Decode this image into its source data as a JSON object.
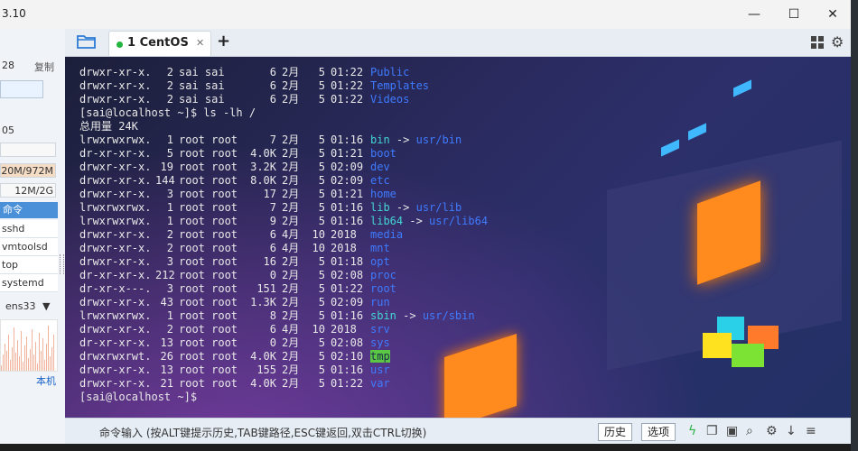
{
  "window": {
    "title_fragment": "3.10",
    "controls": {
      "minimize": "—",
      "maximize": "☐",
      "close": "✕"
    }
  },
  "left_panel": {
    "ip_fragment": "28",
    "copy_label": "复制",
    "load_fragment": "05",
    "mem_usage": "20M/972M",
    "swap_usage": "12M/2G",
    "process_header": "命令",
    "processes": [
      "sshd",
      "vmtoolsd",
      "top",
      "systemd"
    ],
    "net_interface": "ens33",
    "local_label": "本机"
  },
  "tabs": [
    {
      "label": "1 CentOS",
      "status_color": "#25b53e"
    }
  ],
  "terminal": {
    "top_entries": [
      {
        "perm": "drwxr-xr-x.",
        "links": "2",
        "owner": "sai sai",
        "size": "6",
        "month": "2月",
        "day": "5",
        "time": "01:22",
        "name": "Public"
      },
      {
        "perm": "drwxr-xr-x.",
        "links": "2",
        "owner": "sai sai",
        "size": "6",
        "month": "2月",
        "day": "5",
        "time": "01:22",
        "name": "Templates"
      },
      {
        "perm": "drwxr-xr-x.",
        "links": "2",
        "owner": "sai sai",
        "size": "6",
        "month": "2月",
        "day": "5",
        "time": "01:22",
        "name": "Videos"
      }
    ],
    "prompt_command": "[sai@localhost ~]$ ls -lh /",
    "total": "总用量 24K",
    "entries": [
      {
        "perm": "lrwxrwxrwx.",
        "links": "1",
        "owner": "root root",
        "size": "7",
        "month": "2月",
        "day": "5",
        "time": "01:16",
        "name": "bin",
        "target": "usr/bin",
        "kind": "link"
      },
      {
        "perm": "dr-xr-xr-x.",
        "links": "5",
        "owner": "root root",
        "size": "4.0K",
        "month": "2月",
        "day": "5",
        "time": "01:21",
        "name": "boot",
        "target": "",
        "kind": "dir"
      },
      {
        "perm": "drwxr-xr-x.",
        "links": "19",
        "owner": "root root",
        "size": "3.2K",
        "month": "2月",
        "day": "5",
        "time": "02:09",
        "name": "dev",
        "target": "",
        "kind": "dir"
      },
      {
        "perm": "drwxr-xr-x.",
        "links": "144",
        "owner": "root root",
        "size": "8.0K",
        "month": "2月",
        "day": "5",
        "time": "02:09",
        "name": "etc",
        "target": "",
        "kind": "dir"
      },
      {
        "perm": "drwxr-xr-x.",
        "links": "3",
        "owner": "root root",
        "size": "17",
        "month": "2月",
        "day": "5",
        "time": "01:21",
        "name": "home",
        "target": "",
        "kind": "dir"
      },
      {
        "perm": "lrwxrwxrwx.",
        "links": "1",
        "owner": "root root",
        "size": "7",
        "month": "2月",
        "day": "5",
        "time": "01:16",
        "name": "lib",
        "target": "usr/lib",
        "kind": "link"
      },
      {
        "perm": "lrwxrwxrwx.",
        "links": "1",
        "owner": "root root",
        "size": "9",
        "month": "2月",
        "day": "5",
        "time": "01:16",
        "name": "lib64",
        "target": "usr/lib64",
        "kind": "link"
      },
      {
        "perm": "drwxr-xr-x.",
        "links": "2",
        "owner": "root root",
        "size": "6",
        "month": "4月",
        "day": "10",
        "time": "2018",
        "name": "media",
        "target": "",
        "kind": "dir"
      },
      {
        "perm": "drwxr-xr-x.",
        "links": "2",
        "owner": "root root",
        "size": "6",
        "month": "4月",
        "day": "10",
        "time": "2018",
        "name": "mnt",
        "target": "",
        "kind": "dir"
      },
      {
        "perm": "drwxr-xr-x.",
        "links": "3",
        "owner": "root root",
        "size": "16",
        "month": "2月",
        "day": "5",
        "time": "01:18",
        "name": "opt",
        "target": "",
        "kind": "dir"
      },
      {
        "perm": "dr-xr-xr-x.",
        "links": "212",
        "owner": "root root",
        "size": "0",
        "month": "2月",
        "day": "5",
        "time": "02:08",
        "name": "proc",
        "target": "",
        "kind": "dir"
      },
      {
        "perm": "dr-xr-x---.",
        "links": "3",
        "owner": "root root",
        "size": "151",
        "month": "2月",
        "day": "5",
        "time": "01:22",
        "name": "root",
        "target": "",
        "kind": "dir"
      },
      {
        "perm": "drwxr-xr-x.",
        "links": "43",
        "owner": "root root",
        "size": "1.3K",
        "month": "2月",
        "day": "5",
        "time": "02:09",
        "name": "run",
        "target": "",
        "kind": "dir"
      },
      {
        "perm": "lrwxrwxrwx.",
        "links": "1",
        "owner": "root root",
        "size": "8",
        "month": "2月",
        "day": "5",
        "time": "01:16",
        "name": "sbin",
        "target": "usr/sbin",
        "kind": "link"
      },
      {
        "perm": "drwxr-xr-x.",
        "links": "2",
        "owner": "root root",
        "size": "6",
        "month": "4月",
        "day": "10",
        "time": "2018",
        "name": "srv",
        "target": "",
        "kind": "dir"
      },
      {
        "perm": "dr-xr-xr-x.",
        "links": "13",
        "owner": "root root",
        "size": "0",
        "month": "2月",
        "day": "5",
        "time": "02:08",
        "name": "sys",
        "target": "",
        "kind": "dir"
      },
      {
        "perm": "drwxrwxrwt.",
        "links": "26",
        "owner": "root root",
        "size": "4.0K",
        "month": "2月",
        "day": "5",
        "time": "02:10",
        "name": "tmp",
        "target": "",
        "kind": "sticky"
      },
      {
        "perm": "drwxr-xr-x.",
        "links": "13",
        "owner": "root root",
        "size": "155",
        "month": "2月",
        "day": "5",
        "time": "01:16",
        "name": "usr",
        "target": "",
        "kind": "dir"
      },
      {
        "perm": "drwxr-xr-x.",
        "links": "21",
        "owner": "root root",
        "size": "4.0K",
        "month": "2月",
        "day": "5",
        "time": "01:22",
        "name": "var",
        "target": "",
        "kind": "dir"
      }
    ],
    "final_prompt": "[sai@localhost ~]$"
  },
  "command_bar": {
    "hint": "命令输入 (按ALT键提示历史,TAB键路径,ESC键返回,双击CTRL切换)",
    "history_button": "历史",
    "options_button": "选项",
    "icons": [
      "lightning-icon",
      "copy-icon",
      "files-icon",
      "search-icon",
      "gear-icon",
      "download-icon",
      "menu-icon"
    ]
  },
  "colors": {
    "dir": "#3f7bff",
    "link": "#43d6d2",
    "sticky_bg": "#5ac844",
    "accent": "#4a90d9"
  }
}
